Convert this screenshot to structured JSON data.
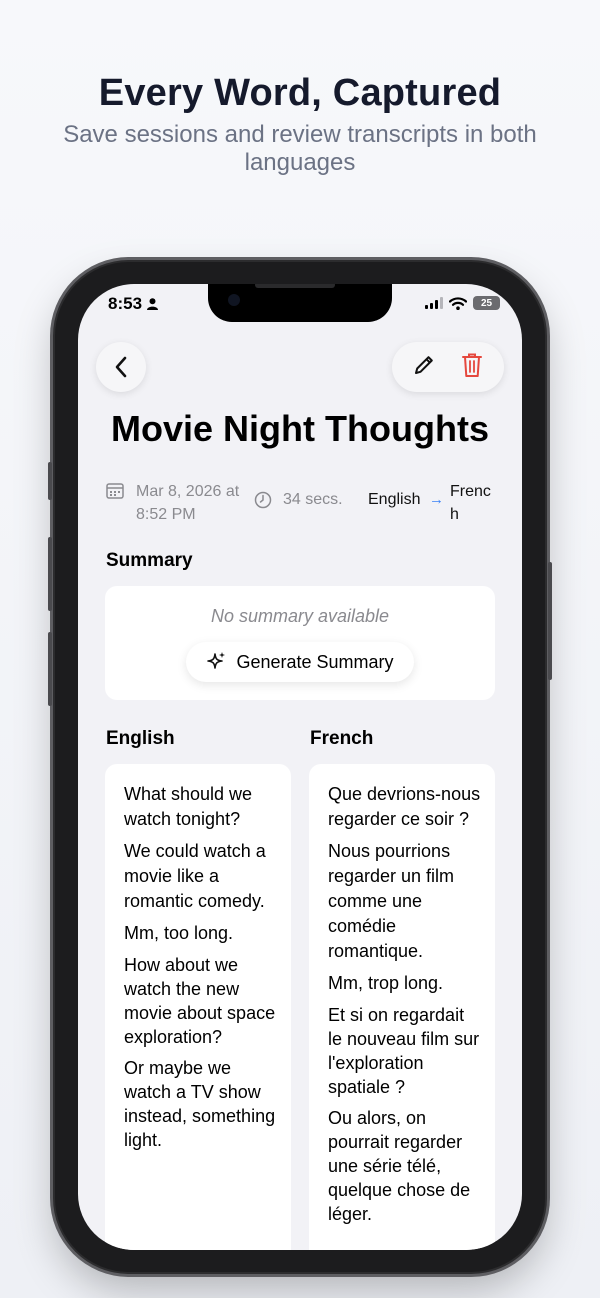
{
  "marketing": {
    "headline": "Every Word, Captured",
    "subheadline": "Save sessions and review transcripts in both languages"
  },
  "status_bar": {
    "time": "8:53",
    "battery": "25"
  },
  "recording": {
    "title": "Movie Night Thoughts",
    "date": "Mar 8, 2026 at 8:52 PM",
    "duration": "34 secs.",
    "source_language": "English",
    "target_language": "French"
  },
  "summary": {
    "label": "Summary",
    "empty_text": "No summary available",
    "generate_label": "Generate Summary"
  },
  "transcript": {
    "source_label": "English",
    "target_label": "French",
    "source_lines": [
      "What should we watch tonight?",
      "We could watch a movie like a romantic comedy.",
      "Mm, too long.",
      "How about we watch the new movie about space exploration?",
      "Or maybe we watch a TV show instead, something light."
    ],
    "target_lines": [
      "Que devrions-nous regarder ce soir ?",
      "Nous pourrions regarder un film comme une comédie romantique.",
      "Mm, trop long.",
      "Et si on regardait le nouveau film sur l'exploration spatiale ?",
      "Ou alors, on pourrait regarder une série télé, quelque chose de léger."
    ]
  },
  "colors": {
    "accent_arrow": "#3a82f6",
    "delete_red": "#e5483e"
  },
  "icons": [
    "calendar-icon",
    "clock-icon",
    "pencil-icon",
    "trash-icon",
    "chevron-left-icon",
    "sparkle-icon"
  ]
}
